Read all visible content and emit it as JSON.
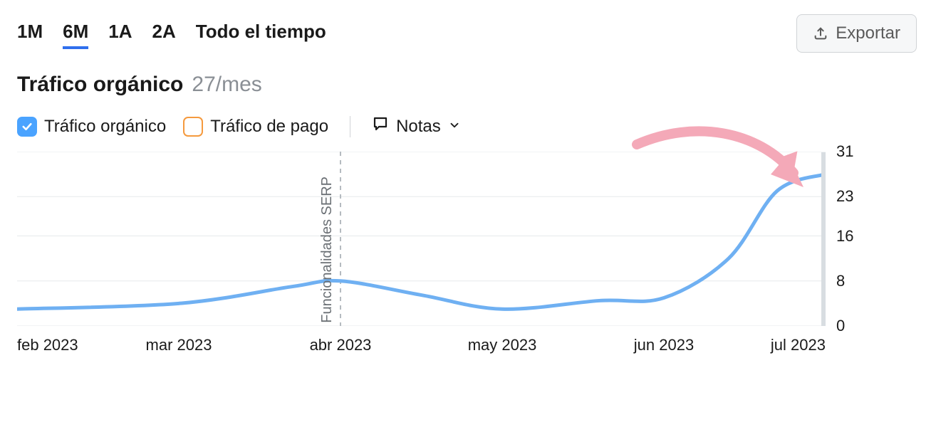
{
  "tabs": {
    "t1": "1M",
    "t2": "6M",
    "t3": "1A",
    "t4": "2A",
    "t5": "Todo el tiempo",
    "active": "6M"
  },
  "export_label": "Exportar",
  "title": "Tráfico orgánico",
  "title_value": "27/mes",
  "legend": {
    "organic": "Tráfico orgánico",
    "paid": "Tráfico de pago",
    "notes": "Notas"
  },
  "annotations": {
    "serp": "Funcionalidades SERP"
  },
  "chart_data": {
    "type": "line",
    "categories": [
      "feb 2023",
      "mar 2023",
      "abr 2023",
      "may 2023",
      "jun 2023",
      "jul 2023"
    ],
    "series": [
      {
        "name": "Tráfico orgánico",
        "color": "#6fb0f2",
        "values": [
          3,
          4,
          8,
          3,
          5,
          27
        ]
      }
    ],
    "xlabel": "",
    "ylabel": "",
    "ylim": [
      0,
      31
    ],
    "yticks": [
      0,
      8,
      16,
      23,
      31
    ],
    "vlines": [
      {
        "label": "Funcionalidades SERP",
        "x_index": 2
      }
    ]
  }
}
